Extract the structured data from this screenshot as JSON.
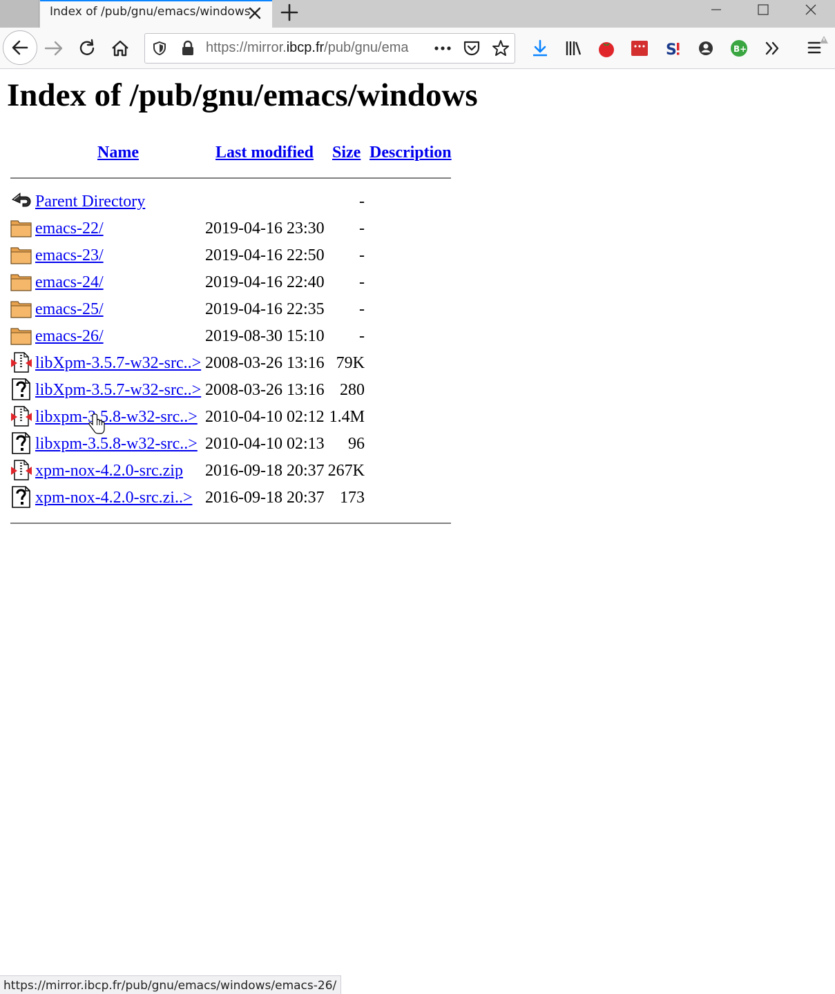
{
  "browser": {
    "tab_title": "Index of /pub/gnu/emacs/windows",
    "url_prefix": "https://mirror.",
    "url_domain": "ibcp.fr",
    "url_suffix": "/pub/gnu/ema",
    "status_text": "https://mirror.ibcp.fr/pub/gnu/emacs/windows/emacs-26/",
    "accent_color": "#0a84ff"
  },
  "page": {
    "heading": "Index of /pub/gnu/emacs/windows",
    "columns": {
      "name": "Name",
      "last_modified": "Last modified",
      "size": "Size",
      "description": "Description"
    },
    "rows": [
      {
        "icon": "back-icon",
        "name": "Parent Directory",
        "date": "",
        "size": "-"
      },
      {
        "icon": "folder-icon",
        "name": "emacs-22/",
        "date": "2019-04-16 23:30",
        "size": "-"
      },
      {
        "icon": "folder-icon",
        "name": "emacs-23/",
        "date": "2019-04-16 22:50",
        "size": "-"
      },
      {
        "icon": "folder-icon",
        "name": "emacs-24/",
        "date": "2019-04-16 22:40",
        "size": "-"
      },
      {
        "icon": "folder-icon",
        "name": "emacs-25/",
        "date": "2019-04-16 22:35",
        "size": "-"
      },
      {
        "icon": "folder-icon",
        "name": "emacs-26/",
        "date": "2019-08-30 15:10",
        "size": "-"
      },
      {
        "icon": "compressed-icon",
        "name": "libXpm-3.5.7-w32-src..>",
        "date": "2008-03-26 13:16",
        "size": "79K"
      },
      {
        "icon": "unknown-file-icon",
        "name": "libXpm-3.5.7-w32-src..>",
        "date": "2008-03-26 13:16",
        "size": "280"
      },
      {
        "icon": "compressed-icon",
        "name": "libxpm-3.5.8-w32-src..>",
        "date": "2010-04-10 02:12",
        "size": "1.4M"
      },
      {
        "icon": "unknown-file-icon",
        "name": "libxpm-3.5.8-w32-src..>",
        "date": "2010-04-10 02:13",
        "size": "96"
      },
      {
        "icon": "compressed-icon",
        "name": "xpm-nox-4.2.0-src.zip",
        "date": "2016-09-18 20:37",
        "size": "267K"
      },
      {
        "icon": "unknown-file-icon",
        "name": "xpm-nox-4.2.0-src.zi..>",
        "date": "2016-09-18 20:37",
        "size": "173"
      }
    ]
  }
}
